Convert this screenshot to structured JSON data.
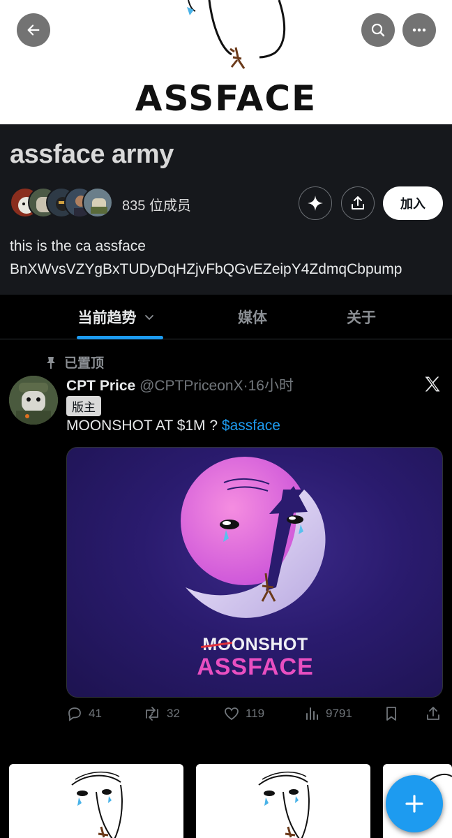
{
  "banner": {
    "word": "ASSFACE"
  },
  "community": {
    "name": "assface army",
    "member_count": "835 位成员",
    "join_label": "加入",
    "description_line1": "this is the ca assface",
    "description_line2": "BnXWvsVZYgBxTUDyDqHZjvFbQGvEZeipY4ZdmqCbpump"
  },
  "tabs": [
    {
      "label": "当前趋势",
      "active": true
    },
    {
      "label": "媒体",
      "active": false
    },
    {
      "label": "关于",
      "active": false
    }
  ],
  "post": {
    "pinned_label": "已置顶",
    "author": "CPT Price",
    "handle": "@CPTPriceonX",
    "separator": "·",
    "time": "16小时",
    "badge": "版主",
    "text": "MOONSHOT AT $1M ? ",
    "cashtag": "$assface",
    "media": {
      "strike_text": "MO",
      "line1_rest": "ONSHOT",
      "line2": "ASSFACE",
      "accent_color": "#e94fc1"
    },
    "stats": {
      "replies": "41",
      "reposts": "32",
      "likes": "119",
      "views": "9791"
    }
  },
  "colors": {
    "accent": "#1d9bf0",
    "background": "#000000",
    "header_bg": "#16181c"
  }
}
